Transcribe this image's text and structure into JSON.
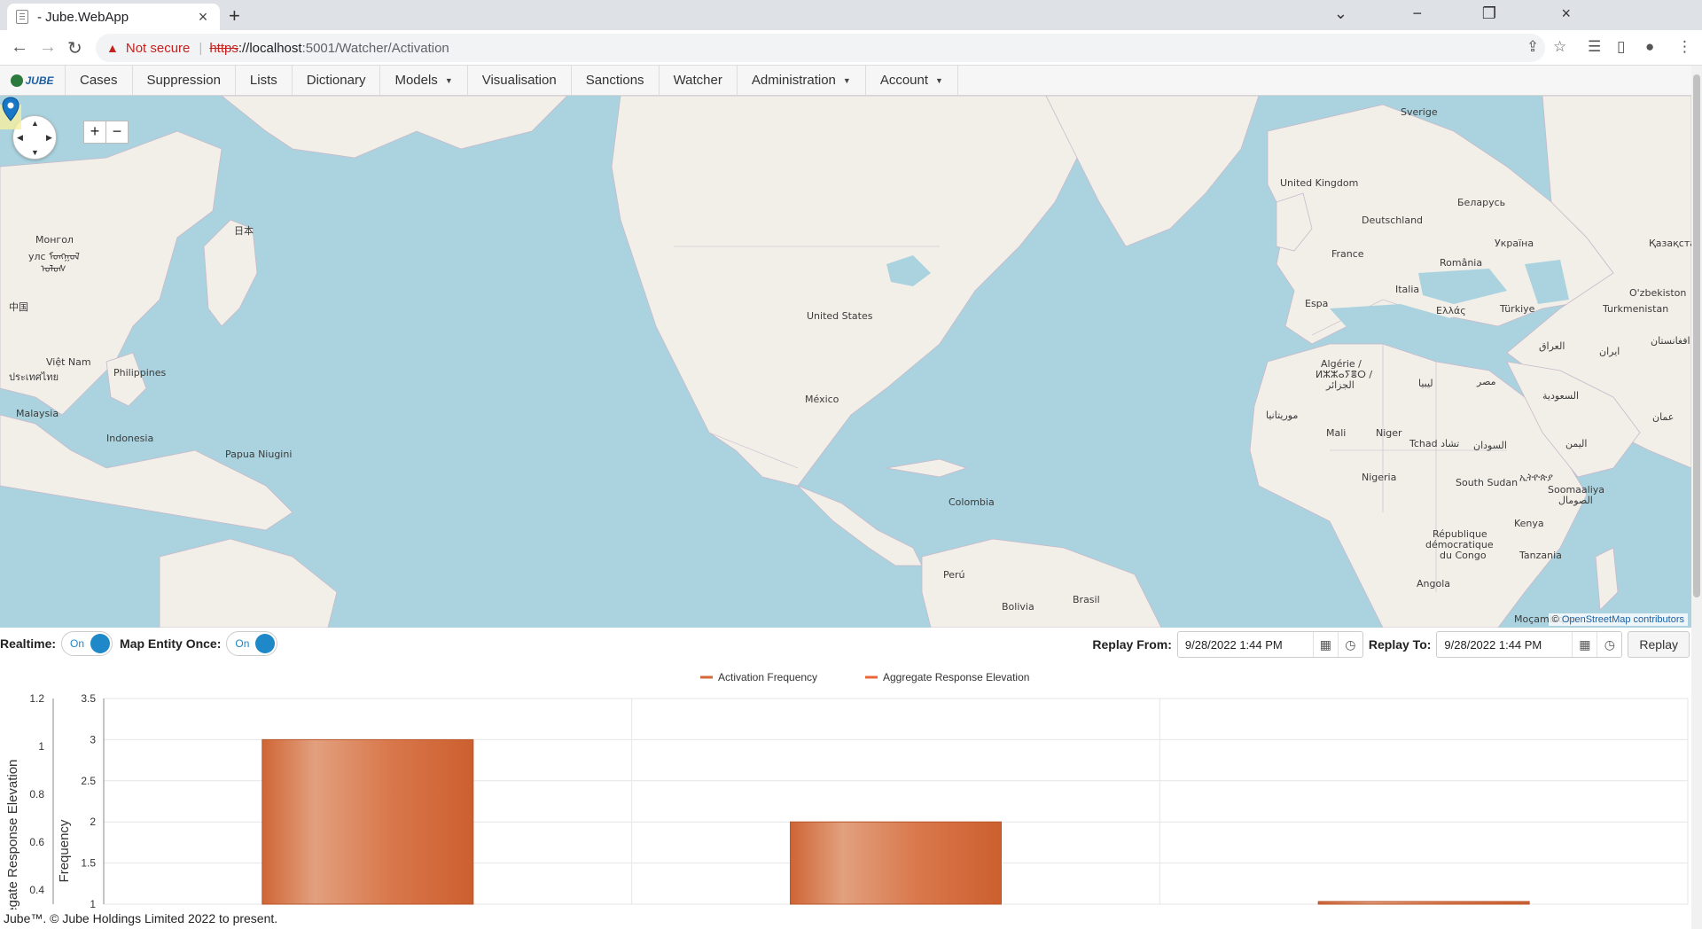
{
  "browser": {
    "tab_title": "- Jube.WebApp",
    "tab_close": "×",
    "new_tab": "+",
    "security_warning": "Not secure",
    "url_scheme": "https",
    "url_host": "://localhost",
    "url_path": ":5001/Watcher/Activation"
  },
  "app_nav": {
    "logo_text": "JUBE",
    "items": [
      {
        "label": "Cases"
      },
      {
        "label": "Suppression"
      },
      {
        "label": "Lists"
      },
      {
        "label": "Dictionary"
      },
      {
        "label": "Models",
        "dropdown": true
      },
      {
        "label": "Visualisation"
      },
      {
        "label": "Sanctions"
      },
      {
        "label": "Watcher"
      },
      {
        "label": "Administration",
        "dropdown": true
      },
      {
        "label": "Account",
        "dropdown": true
      }
    ]
  },
  "map": {
    "attribution_prefix": "©",
    "attribution_link": "OpenStreetMap contributors",
    "zoom_in": "+",
    "zoom_out": "−",
    "labels": {
      "mongol": "Монгол",
      "mongol_script": "улс ᠮᠣᠩᠭᠣᠯ",
      "mongol_script2": "ᠤᠯᠤᠰ",
      "japan": "日本",
      "china": "中国",
      "vietnam": "Việt Nam",
      "thailand": "ประเทศไทย",
      "philippines": "Philippines",
      "malaysia": "Malaysia",
      "indonesia": "Indonesia",
      "png": "Papua Niugini",
      "usa": "United States",
      "mexico": "México",
      "colombia": "Colombia",
      "peru": "Perú",
      "bolivia": "Bolivia",
      "brasil": "Brasil",
      "sverige": "Sverige",
      "uk": "United Kingdom",
      "belarus": "Беларусь",
      "deutschland": "Deutschland",
      "ukraina": "Україна",
      "kazakhstan": "Қазақстан",
      "france": "France",
      "romania": "România",
      "espana": "Espa",
      "italia": "Italia",
      "ellas": "Ελλάς",
      "turkiye": "Türkiye",
      "uzbekistan": "O'zbekiston",
      "turkmenistan": "Turkmenistan",
      "algerie": "Algérie /",
      "algerie2": "ⵍⵣⵣⴰⵢⴻⵔ /",
      "algerie3": "الجزائر",
      "iraq": "العراق",
      "iran": "ایران",
      "afghanistan": "افغانستان",
      "libya": "ليبيا",
      "egypt": "مصر",
      "saudi": "السعودية",
      "oman": "عمان",
      "mauritania": "موريتانيا",
      "mali": "Mali",
      "niger": "Niger",
      "chad": "Tchad تشاد",
      "sudan": "السودان",
      "yemen": "اليمن",
      "nigeria": "Nigeria",
      "south_sudan": "South Sudan",
      "ethiopia": "ኢትዮጵያ",
      "somalia": "Soomaaliya",
      "somalia2": "الصومال",
      "kenya": "Kenya",
      "drc": "République",
      "drc2": "démocratique",
      "drc3": "du Congo",
      "tanzania": "Tanzania",
      "angola": "Angola",
      "mozambique": "Moçambique"
    }
  },
  "controls": {
    "realtime_label": "Realtime:",
    "realtime_state": "On",
    "map_entity_label": "Map Entity Once:",
    "map_entity_state": "On",
    "replay_from_label": "Replay From:",
    "replay_from_value": "9/28/2022 1:44 PM",
    "replay_to_label": "Replay To:",
    "replay_to_value": "9/28/2022 1:44 PM",
    "replay_button": "Replay"
  },
  "chart_data": {
    "type": "bar",
    "categories": [
      "",
      "",
      ""
    ],
    "series": [
      {
        "name": "Activation Frequency",
        "axis": "frequency",
        "values": [
          3,
          2,
          1
        ],
        "color": "#d4683a"
      },
      {
        "name": "Aggregate Response Elevation",
        "axis": "elevation",
        "values": [
          0,
          0,
          0
        ],
        "color": "#e8683a"
      }
    ],
    "ylabel_left_outer": "Aggregate Response Elevation",
    "ylabel_left_inner": "Frequency",
    "y_outer_ticks": [
      "1.2",
      "1",
      "0.8",
      "0.6",
      "0.4"
    ],
    "y_inner_ticks": [
      "3.5",
      "3",
      "2.5",
      "2",
      "1.5",
      "1"
    ],
    "y_inner_range": [
      1,
      3.5
    ],
    "legend_position": "top-center",
    "grid": true
  },
  "footer": {
    "text": "Jube™. © Jube Holdings Limited 2022 to present."
  },
  "colors": {
    "water": "#aad3df",
    "land": "#f2efe9",
    "accent": "#1e88c8",
    "bar": "#d4683a"
  }
}
